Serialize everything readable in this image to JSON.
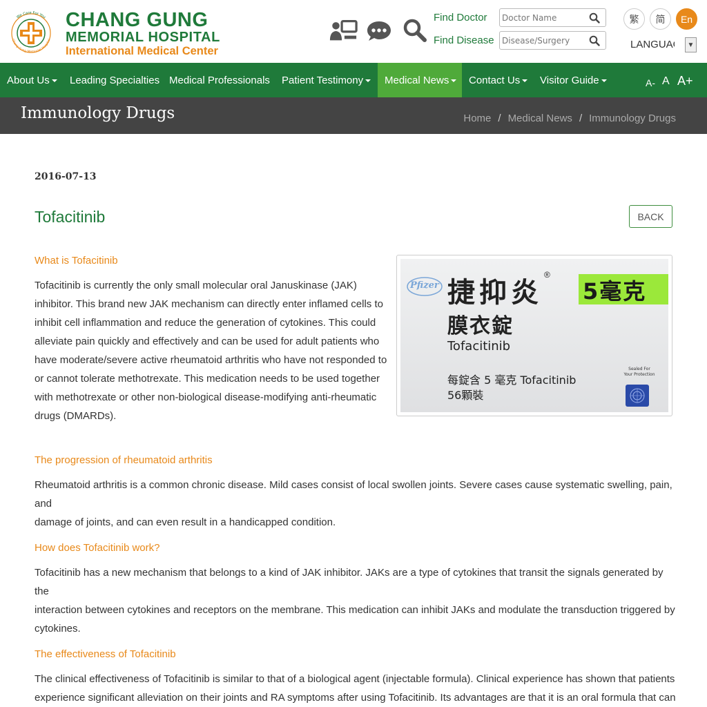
{
  "header": {
    "logo": {
      "line1": "CHANG GUNG",
      "line2": "MEMORIAL HOSPITAL",
      "line3": "International Medical Center",
      "emblem_text": "We Care For You · Chang Gung Memorial Hospital"
    },
    "icons": [
      "telemedicine-icon",
      "chat-icon",
      "search-icon"
    ],
    "find_doctor": {
      "label": "Find Doctor",
      "placeholder": "Doctor Name"
    },
    "find_disease": {
      "label": "Find Disease",
      "placeholder": "Disease/Surgery"
    },
    "languages": [
      {
        "label": "繁",
        "active": false
      },
      {
        "label": "简",
        "active": false
      },
      {
        "label": "En",
        "active": true
      }
    ],
    "language_select": "LANGUAGE"
  },
  "nav": {
    "items": [
      {
        "label": "About Us",
        "dropdown": true
      },
      {
        "label": "Leading Specialties",
        "dropdown": false
      },
      {
        "label": "Medical Professionals",
        "dropdown": false
      },
      {
        "label": "Patient Testimony",
        "dropdown": true
      },
      {
        "label": "Medical News",
        "dropdown": true,
        "active": true
      },
      {
        "label": "Contact Us",
        "dropdown": true
      },
      {
        "label": "Visitor Guide",
        "dropdown": true
      }
    ],
    "font_size": {
      "decrease": "A-",
      "normal": "A",
      "increase": "A+"
    }
  },
  "titlebar": {
    "title": "Immunology Drugs",
    "breadcrumb": [
      "Home",
      "Medical News",
      "Immunology Drugs"
    ],
    "separator": "/"
  },
  "article": {
    "date": "2016-07-13",
    "title": "Tofacitinib",
    "back_label": "BACK",
    "sections": [
      {
        "heading": "What is Tofacitinib",
        "lines": [
          "Tofacitinib is currently the only small molecular oral Januskinase (JAK)",
          "inhibitor. This brand new JAK mechanism can directly enter inflamed cells to",
          "inhibit cell inflammation and reduce the generation of cytokines. This could",
          "alleviate pain quickly and effectively and can be used for adult patients who",
          "have moderate/severe active rheumatoid arthritis who have not responded to",
          "or cannot tolerate methotrexate. This medication needs to be used together",
          "with methotrexate or other non-biological disease-modifying anti-rheumatic",
          "drugs (DMARDs)."
        ]
      },
      {
        "heading": "The progression of rheumatoid arthritis",
        "lines": [
          "Rheumatoid arthritis is a common chronic disease. Mild cases consist of local swollen joints. Severe cases cause systematic swelling, pain, and",
          "damage of joints, and can even result in a handicapped condition."
        ]
      },
      {
        "heading": "How does Tofacitinib work?",
        "lines": [
          "Tofacitinib has a new mechanism that belongs to a kind of JAK inhibitor. JAKs are a type of cytokines that transit the signals generated by the",
          "interaction between cytokines and receptors on the membrane. This medication can inhibit JAKs and modulate the transduction triggered by",
          "cytokines."
        ]
      },
      {
        "heading": "The effectiveness of Tofacitinib",
        "lines": [
          "The clinical effectiveness of Tofacitinib is similar to that of a biological agent (injectable formula). Clinical experience has shown that patients",
          "experience significant alleviation on their joints and RA symptoms after using Tofacitinib. Its advantages are that it is an oral formula that can"
        ]
      }
    ],
    "image": {
      "brand": "Pfizer",
      "name_zh": "捷抑炎",
      "registered": "®",
      "dose_zh": "5毫克",
      "form_zh": "膜衣錠",
      "name_en": "Tofacitinib",
      "per_tablet": "每錠含 5 毫克 Tofacitinib",
      "count": "56顆裝",
      "seal_line1": "Sealed For",
      "seal_line2": "Your Protection"
    }
  },
  "colors": {
    "brand_green": "#1f7a3a",
    "active_green": "#4faa3a",
    "accent_orange": "#e8891a",
    "titlebar_gray": "#444444",
    "dose_lime": "#9be83a"
  }
}
